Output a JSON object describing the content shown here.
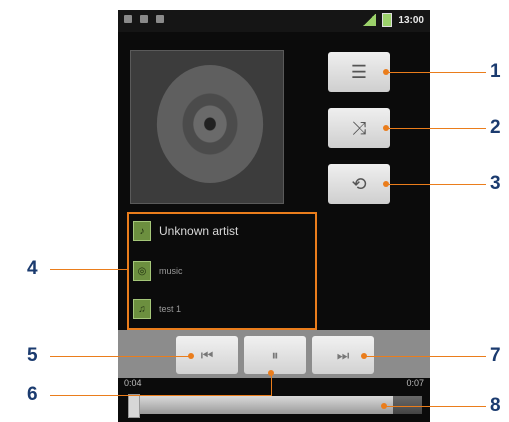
{
  "statusbar": {
    "time": "13:00",
    "icons": [
      "notification-icon",
      "usb-icon",
      "signal-icon",
      "battery-icon"
    ]
  },
  "album": {
    "art_icon": "disc-icon"
  },
  "side_buttons": [
    {
      "name": "playlist-button",
      "icon": "list-icon"
    },
    {
      "name": "shuffle-button",
      "icon": "shuffle-icon"
    },
    {
      "name": "repeat-button",
      "icon": "repeat-icon"
    }
  ],
  "track_info": {
    "artist": "Unknown artist",
    "album": "music",
    "title": "test 1"
  },
  "controls": {
    "prev_icon": "previous-icon",
    "pause_icon": "pause-icon",
    "next_icon": "next-icon"
  },
  "progress": {
    "elapsed": "0:04",
    "duration": "0:07",
    "fraction": 0.9
  },
  "callouts": {
    "c1": "1",
    "c2": "2",
    "c3": "3",
    "c4": "4",
    "c5": "5",
    "c6": "6",
    "c7": "7",
    "c8": "8"
  },
  "colors": {
    "callout": "#ea7d1c",
    "callout_text": "#1b3b6f"
  }
}
